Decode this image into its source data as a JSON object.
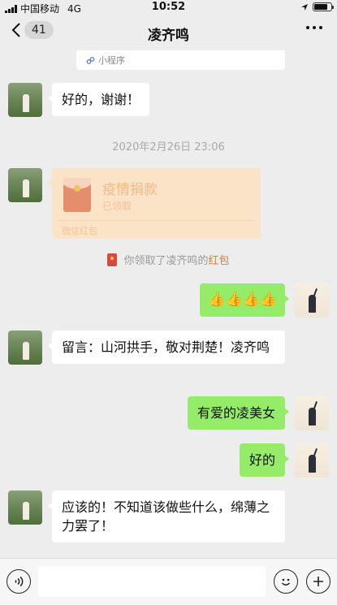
{
  "status_bar": {
    "carrier": "中国移动",
    "network": "4G",
    "time": "10:52"
  },
  "navbar": {
    "back_badge": "41",
    "title": "凌齐鸣"
  },
  "mini_program": {
    "label": "小程序"
  },
  "messages": [
    {
      "side": "left",
      "text": "好的，谢谢！"
    },
    {
      "side": "right",
      "text": "👍👍👍👍"
    },
    {
      "side": "left",
      "text": "留言：山河拱手，敬对荆楚！凌齐鸣"
    },
    {
      "side": "right",
      "text": "有爱的凌美女"
    },
    {
      "side": "right",
      "text": "好的"
    },
    {
      "side": "left",
      "text": "应该的！不知道该做些什么，绵薄之力罢了！"
    }
  ],
  "timestamp": "2020年2月26日 23:06",
  "red_packet": {
    "title": "疫情捐款",
    "status": "已领取",
    "footer": "微信红包"
  },
  "system_message": {
    "text": "你领取了凌齐鸣的",
    "link": "红包"
  },
  "input_bar": {
    "placeholder": ""
  },
  "colors": {
    "chat_background": "#ededed",
    "self_bubble": "#95ec69",
    "other_bubble": "#ffffff",
    "red_packet_received": "#fae3c6",
    "link_orange": "#e07b3a"
  }
}
